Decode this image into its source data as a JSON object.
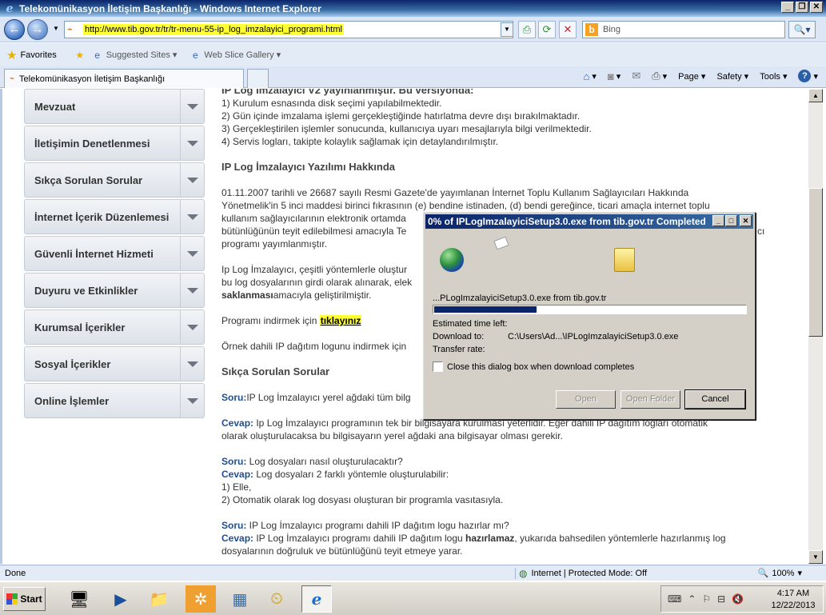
{
  "window": {
    "title": "Telekomünikasyon İletişim Başkanlığı - Windows Internet Explorer",
    "controls": [
      "_",
      "❐",
      "✕"
    ]
  },
  "address": {
    "url_prefix": "http://www.",
    "url_domain": "tib.gov.tr",
    "url_rest": "/tr/tr-menu-55-ip_log_imzalayici_programi.html",
    "search_placeholder": "Bing"
  },
  "favorites": {
    "label": "Favorites",
    "items": [
      {
        "label": "Suggested Sites ▾",
        "icon": "ie-icon"
      },
      {
        "label": "Web Slice Gallery ▾",
        "icon": "ie-icon"
      }
    ]
  },
  "tab": {
    "title": "Telekomünikasyon İletişim Başkanlığı"
  },
  "commands": [
    {
      "label": "▾",
      "icon": "home-icon"
    },
    {
      "label": "▾",
      "icon": "rss-icon"
    },
    {
      "label": "▾",
      "icon": "print-icon"
    },
    {
      "label": "Page ▾",
      "icon": "page-icon"
    },
    {
      "label": "Safety ▾",
      "icon": "safety-icon"
    },
    {
      "label": "Tools ▾",
      "icon": "tools-icon"
    },
    {
      "label": "▾",
      "icon": "help-icon"
    }
  ],
  "sidebar": {
    "items": [
      {
        "label": "Mevzuat"
      },
      {
        "label": "İletişimin Denetlenmesi"
      },
      {
        "label": "Sıkça Sorulan Sorular"
      },
      {
        "label": "İnternet İçerik Düzenlemesi"
      },
      {
        "label": "Güvenli İnternet Hizmeti"
      },
      {
        "label": "Duyuru ve Etkinlikler"
      },
      {
        "label": "Kurumsal İçerikler"
      },
      {
        "label": "Sosyal İçerikler"
      },
      {
        "label": "Online İşlemler"
      }
    ]
  },
  "main": {
    "intro": "IP Log İmzalayıcı V2 yayınlanmıştır. Bu versiyonda:",
    "features": [
      "1) Kurulum esnasında disk seçimi yapılabilmektedir.",
      "2) Gün içinde imzalama işlemi gerçekleştiğinde hatırlatma devre dışı bırakılmaktadır.",
      "3) Gerçekleştirilen işlemler sonucunda, kullanıcıya uyarı mesajlarıyla bilgi  verilmektedir.",
      "4) Servis logları, takipte kolaylık sağlamak için detaylandırılmıştır."
    ],
    "about_heading": "IP Log İmzalayıcı Yazılımı Hakkında",
    "about_lines": [
      "01.11.2007 tarihli ve 26687 sayılı Resmi Gazete'de yayımlanan İnternet Toplu Kullanım Sağlayıcıları Hakkında",
      "Yönetmelik'in 5 inci maddesi birinci fıkrasının (e) bendine istinaden, (d) bendi gereğince, ticari amaçla internet toplu",
      "kullanım sağlayıcılarının elektronik ortamda",
      "bütünlüğünün teyit edilebilmesi amacıyla Te",
      "programı yayımlanmıştır."
    ],
    "about_line4_tail": "cı",
    "para2_lines": [
      "Ip Log İmzalayıcı, çeşitli yöntemlerle oluştur",
      "bu log dosyalarının girdi olarak alınarak, elek"
    ],
    "para2_bold": "saklanması",
    "para2_end": "amacıyla geliştirilmiştir.",
    "download_text": "Programı indirmek için ",
    "download_link": "tıklayınız",
    "sample_text": "Örnek dahili IP dağıtım logunu indirmek için",
    "faq_heading": "Sıkça Sorulan Sorular",
    "q1_label": "Soru:",
    "q1_text": "IP Log İmzalayıcı yerel ağdaki tüm bilg",
    "a1_label": "Cevap:",
    "a1_text": " Ip Log İmzalayıcı programının tek bir bilgisayara kurulması yeterlidir. Eğer dahili IP  dağıtım logları otomatik",
    "a1_line2": "olarak oluşturulacaksa bu bilgisayarın yerel ağdaki ana bilgisayar olması gerekir.",
    "q2_label": "Soru:",
    "q2_text": " Log dosyaları nasıl oluşturulacaktır?",
    "a2_label": "Cevap:",
    "a2_text": " Log dosyaları 2 farklı yöntemle oluşturulabilir:",
    "a2_opt1": "1) Elle,",
    "a2_opt2": "2) Otomatik olarak log dosyası oluşturan bir programla vasıtasıyla.",
    "q3_label": "Soru:",
    "q3_text": " IP Log İmzalayıcı programı  dahili IP dağıtım logu hazırlar mı?",
    "a3_label": "Cevap:",
    "a3_text": " IP Log İmzalayıcı programı dahili IP dağıtım logu ",
    "a3_bold": "hazırlamaz",
    "a3_tail": ", yukarıda bahsedilen yöntemlerle hazırlanmış log",
    "a3_line2": "dosyalarının doğruluk ve bütünlüğünü teyit etmeye yarar."
  },
  "dialog": {
    "title": "0% of IPLogImzalayiciSetup3.0.exe from tib.gov.tr Completed",
    "file_line": "...PLogImzalayiciSetup3.0.exe from tib.gov.tr",
    "progress": 0.33,
    "estimated_label": "Estimated time left:",
    "download_to_label": "Download to:",
    "download_to_value": "C:\\Users\\Ad...\\IPLogImzalayiciSetup3.0.exe",
    "transfer_label": "Transfer rate:",
    "checkbox_label": "Close this dialog box when download completes",
    "buttons": {
      "open": "Open",
      "open_folder": "Open Folder",
      "cancel": "Cancel"
    }
  },
  "status": {
    "text": "Done",
    "zone": "Internet | Protected Mode: Off",
    "zoom": "100%"
  },
  "taskbar": {
    "start": "Start",
    "time": "4:17 AM",
    "date": "12/22/2013"
  }
}
